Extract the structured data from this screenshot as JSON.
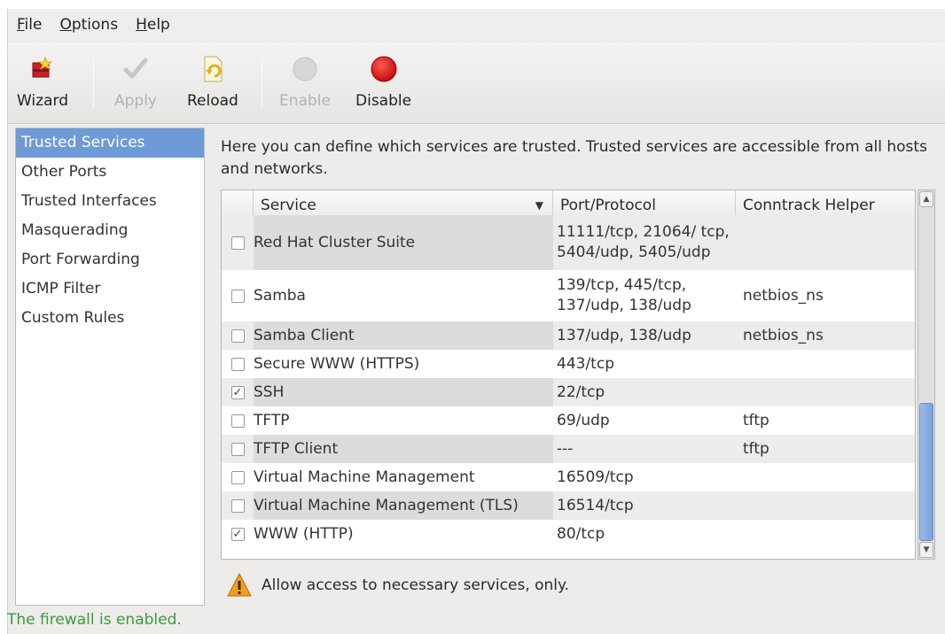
{
  "menubar": [
    {
      "mnemonic": "F",
      "rest": "ile"
    },
    {
      "mnemonic": "O",
      "rest": "ptions"
    },
    {
      "mnemonic": "H",
      "rest": "elp"
    }
  ],
  "toolbar": {
    "wizard": "Wizard",
    "apply": "Apply",
    "reload": "Reload",
    "enable": "Enable",
    "disable": "Disable"
  },
  "sidebar": {
    "items": [
      "Trusted Services",
      "Other Ports",
      "Trusted Interfaces",
      "Masquerading",
      "Port Forwarding",
      "ICMP Filter",
      "Custom Rules"
    ],
    "selected_index": 0
  },
  "main": {
    "description": "Here you can define which services are trusted. Trusted services are accessible from all hosts and networks.",
    "columns": {
      "service": "Service",
      "port": "Port/Protocol",
      "helper": "Conntrack Helper"
    },
    "rows": [
      {
        "checked": false,
        "service": "Red Hat Cluster Suite",
        "port": "11111/tcp, 21064/ tcp, 5404/udp, 5405/udp",
        "helper": ""
      },
      {
        "checked": false,
        "service": "Samba",
        "port": "139/tcp, 445/tcp, 137/udp, 138/udp",
        "helper": "netbios_ns"
      },
      {
        "checked": false,
        "service": "Samba Client",
        "port": "137/udp, 138/udp",
        "helper": "netbios_ns"
      },
      {
        "checked": false,
        "service": "Secure WWW (HTTPS)",
        "port": "443/tcp",
        "helper": ""
      },
      {
        "checked": true,
        "service": "SSH",
        "port": "22/tcp",
        "helper": ""
      },
      {
        "checked": false,
        "service": "TFTP",
        "port": "69/udp",
        "helper": "tftp"
      },
      {
        "checked": false,
        "service": "TFTP Client",
        "port": "---",
        "helper": "tftp"
      },
      {
        "checked": false,
        "service": "Virtual Machine Management",
        "port": "16509/tcp",
        "helper": ""
      },
      {
        "checked": false,
        "service": "Virtual Machine Management (TLS)",
        "port": "16514/tcp",
        "helper": ""
      },
      {
        "checked": true,
        "service": "WWW (HTTP)",
        "port": "80/tcp",
        "helper": ""
      }
    ],
    "warning": "Allow access to necessary services, only."
  },
  "status": "The firewall is enabled.",
  "colors": {
    "selection": "#6e9ad8",
    "status_text": "#3d9a3d",
    "disable_icon": "#e01a1a",
    "warning_icon": "#f0a020"
  }
}
